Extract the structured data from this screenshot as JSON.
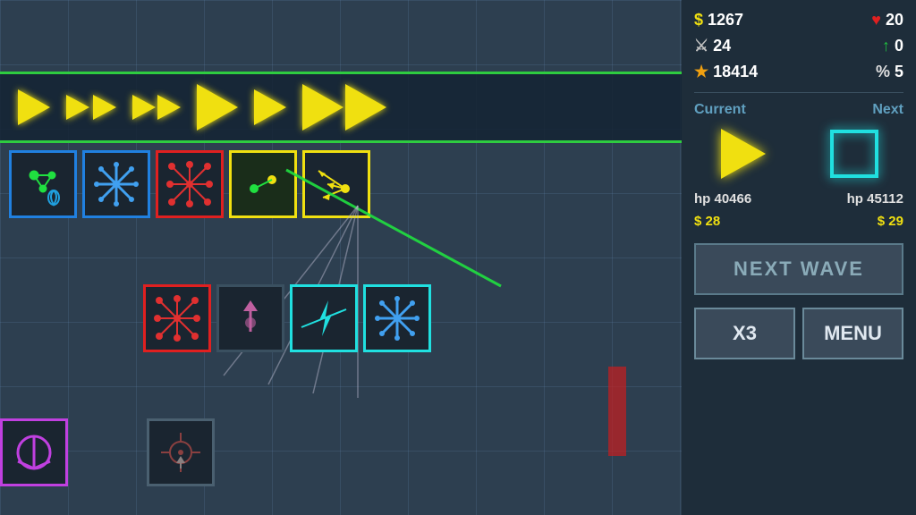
{
  "stats": {
    "money": "1267",
    "hearts": "20",
    "sword": "24",
    "arrow": "0",
    "star": "18414",
    "percent": "5"
  },
  "labels": {
    "current": "Current",
    "next": "Next",
    "current_hp": "hp 40466",
    "next_hp": "hp 45112",
    "current_price": "$ 28",
    "next_price": "$ 29",
    "next_wave": "NEXT WAVE",
    "x3": "X3",
    "menu": "MENU"
  },
  "icons": {
    "dollar": "$",
    "heart": "♥",
    "sword": "⚔",
    "arrow": "↑",
    "star": "★",
    "percent": "%"
  }
}
